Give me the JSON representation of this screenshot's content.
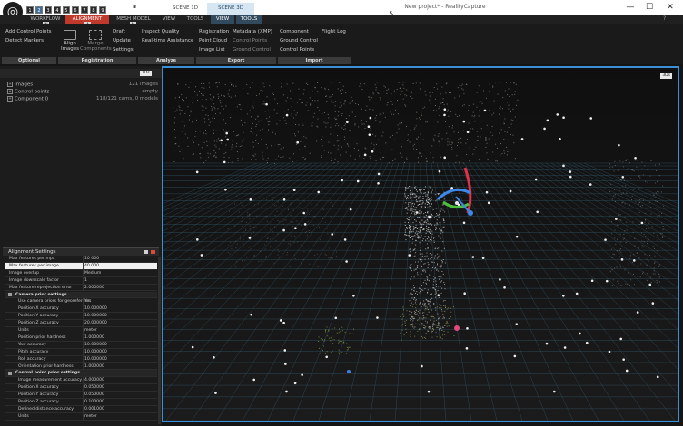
{
  "app": {
    "quick_numbers": [
      "1",
      "2",
      "3",
      "4",
      "5",
      "6",
      "7",
      "8",
      "9"
    ],
    "active_number": "2",
    "window_tabs": [
      {
        "label": "SCENE 1D"
      },
      {
        "label": "SCENE 3D"
      }
    ],
    "document_title": "New project* - RealityCapture",
    "win_buttons": {
      "minimize": "—",
      "maximize": "☐",
      "close": "✕"
    },
    "help_label": "?"
  },
  "menu": {
    "items": [
      "WORKFLOW",
      "ALIGNMENT",
      "MESH MODEL",
      "VIEW",
      "TOOLS"
    ],
    "active": "ALIGNMENT",
    "right_items": [
      "VIEW",
      "TOOLS"
    ],
    "key_hints": {
      "workflow": "W",
      "alignment": "A",
      "mesh": "M"
    }
  },
  "ribbon": {
    "optional": {
      "header": "Optional",
      "items": [
        "Add Control Points",
        "Detect Markers"
      ]
    },
    "registration": {
      "header": "Registration",
      "align_label": "Align\nImages",
      "merge_label": "Merge\nComponents",
      "items": [
        "Draft",
        "Update",
        "Settings"
      ]
    },
    "analyze": {
      "header": "Analyze",
      "items": [
        "Inspect Quality",
        "Real-time Assistance"
      ]
    },
    "export": {
      "header": "Export",
      "col1": [
        "Registration",
        "Point Cloud",
        "Image List"
      ],
      "col2": [
        "Metadata (XMP)",
        "Control Points",
        "Ground Control"
      ]
    },
    "import": {
      "header": "Import",
      "col1": [
        "Component",
        "Ground Control",
        "Control Points"
      ],
      "col2": [
        "Flight Log"
      ]
    }
  },
  "tree": {
    "pill": "1Ds",
    "rows": [
      {
        "label": "Images",
        "value": "121 images"
      },
      {
        "label": "Control points",
        "value": "empty"
      },
      {
        "label": "Component 0",
        "value": "118/121 cams, 0 models"
      }
    ]
  },
  "alignment_settings": {
    "title": "Alignment Settings",
    "rows": [
      {
        "k": "Max features per mpx",
        "v": "10 000",
        "type": "row"
      },
      {
        "k": "Max features per image",
        "v": "40 000",
        "type": "sel"
      },
      {
        "k": "Image overlap",
        "v": "Medium",
        "type": "row"
      },
      {
        "k": "Image downscale factor",
        "v": "1",
        "type": "row"
      },
      {
        "k": "Max feature reprojection error",
        "v": "2.000000",
        "type": "row"
      },
      {
        "k": "Camera prior settings",
        "v": "",
        "type": "sec"
      },
      {
        "k": "Use camera priors for georeferenc...",
        "v": "Yes",
        "type": "ind"
      },
      {
        "k": "Position X accuracy",
        "v": "10.000000",
        "type": "ind"
      },
      {
        "k": "Position Y accuracy",
        "v": "10.000000",
        "type": "ind"
      },
      {
        "k": "Position Z accuracy",
        "v": "20.000000",
        "type": "ind"
      },
      {
        "k": "Units",
        "v": "meter",
        "type": "ind"
      },
      {
        "k": "Position prior hardness",
        "v": "1.000000",
        "type": "ind"
      },
      {
        "k": "Yaw accuracy",
        "v": "10.000000",
        "type": "ind"
      },
      {
        "k": "Pitch accuracy",
        "v": "10.000000",
        "type": "ind"
      },
      {
        "k": "Roll accuracy",
        "v": "10.000000",
        "type": "ind"
      },
      {
        "k": "Orientation prior hardness",
        "v": "1.000000",
        "type": "ind"
      },
      {
        "k": "Control point prior settings",
        "v": "",
        "type": "sec"
      },
      {
        "k": "Image measurement accuracy",
        "v": "4.000000",
        "type": "ind"
      },
      {
        "k": "Position X accuracy",
        "v": "0.050000",
        "type": "ind"
      },
      {
        "k": "Position Y accuracy",
        "v": "0.050000",
        "type": "ind"
      },
      {
        "k": "Position Z accuracy",
        "v": "0.100000",
        "type": "ind"
      },
      {
        "k": "Defined distance accuracy",
        "v": "0.001000",
        "type": "ind"
      },
      {
        "k": "Units",
        "v": "meter",
        "type": "ind"
      }
    ]
  },
  "viewport": {
    "pill": "3Ds",
    "accent": "#3a8fd6",
    "grid_color": "#3d6f8a"
  }
}
